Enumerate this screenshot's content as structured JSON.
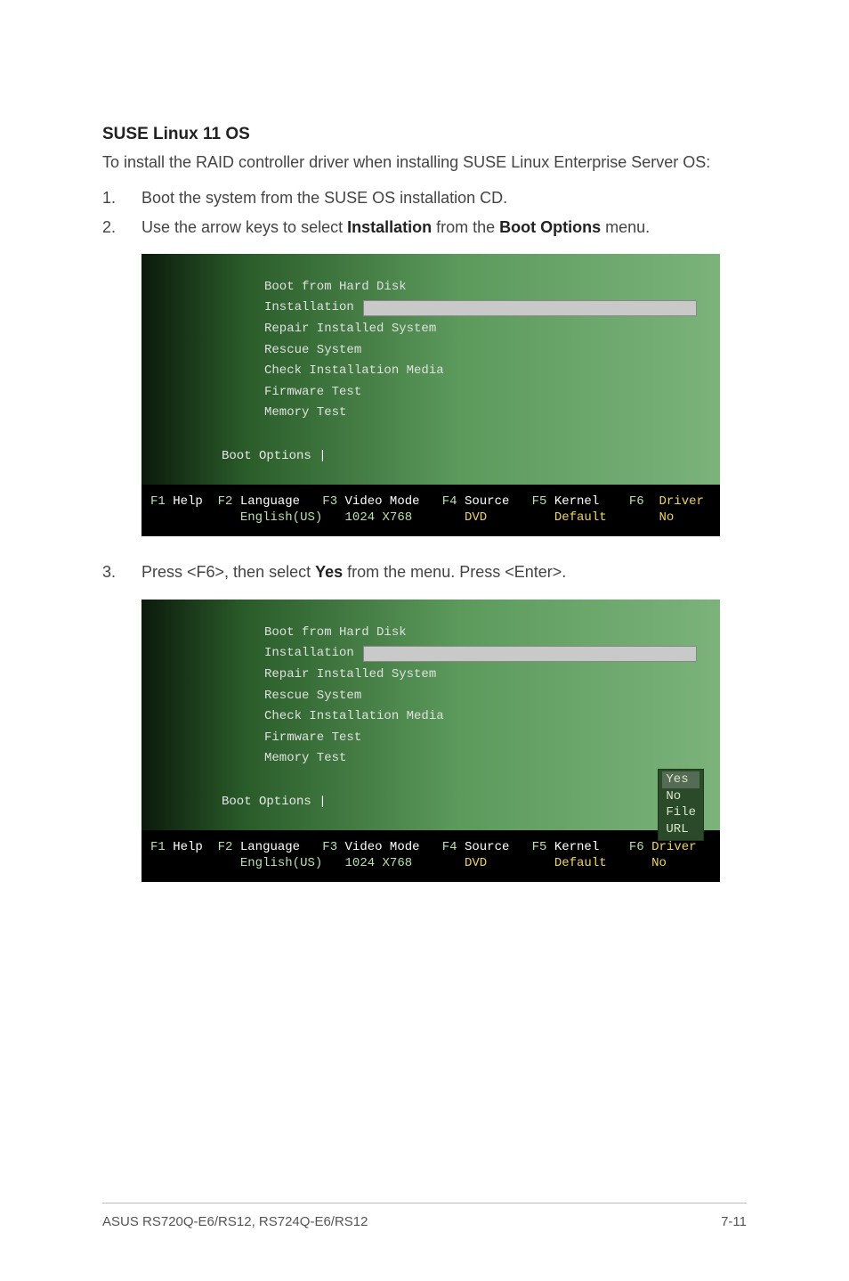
{
  "heading": "SUSE Linux 11 OS",
  "intro": "To install the RAID controller driver when installing SUSE Linux Enterprise Server OS:",
  "steps": [
    {
      "num": "1.",
      "text_plain": "Boot the system from the SUSE OS installation CD."
    },
    {
      "num": "2.",
      "text_before": "Use the arrow keys to select ",
      "bold1": "Installation",
      "mid": " from the ",
      "bold2": "Boot Options",
      "after": " menu."
    },
    {
      "num": "3.",
      "text_before": "Press <F6>, then select ",
      "bold1": "Yes",
      "mid": " from the menu. Press <Enter>."
    }
  ],
  "menu": {
    "items": [
      "Boot from Hard Disk",
      "Installation",
      "Repair Installed System",
      "Rescue System",
      "Check Installation Media",
      "Firmware Test",
      "Memory Test"
    ],
    "selected": "Installation",
    "boot_options_label": "Boot Options "
  },
  "fkeys": {
    "f1": {
      "key": "F1",
      "label": "Help",
      "value": ""
    },
    "f2": {
      "key": "F2",
      "label": "Language",
      "value": "English(US)"
    },
    "f3": {
      "key": "F3",
      "label": "Video Mode",
      "value": "1024 X768"
    },
    "f4": {
      "key": "F4",
      "label": "Source",
      "value": "DVD"
    },
    "f5": {
      "key": "F5",
      "label": "Kernel",
      "value": "Default"
    },
    "f6": {
      "key": "F6",
      "label": "Driver",
      "value": "No"
    }
  },
  "popup": {
    "items": [
      "Yes",
      "No",
      "File",
      "URL"
    ],
    "selected": "Yes"
  },
  "footer": {
    "left": "ASUS RS720Q-E6/RS12, RS724Q-E6/RS12",
    "right": "7-11"
  }
}
